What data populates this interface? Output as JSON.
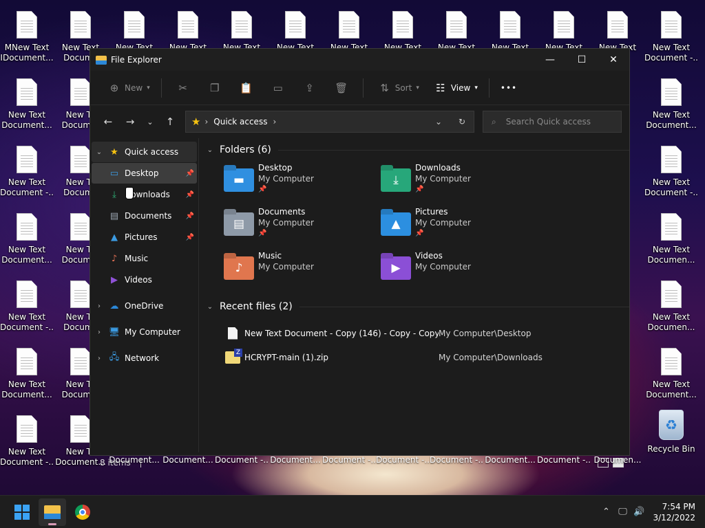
{
  "desktop": {
    "left_col1": [
      {
        "line1": "MNew Text",
        "line2": "IDocument..."
      },
      {
        "line1": "New Text",
        "line2": "Document..."
      },
      {
        "line1": "New Text",
        "line2": "Document -..."
      },
      {
        "line1": "New Text",
        "line2": "Document..."
      },
      {
        "line1": "New Text",
        "line2": "Document -..."
      },
      {
        "line1": "New Text",
        "line2": "Document..."
      },
      {
        "line1": "New Text",
        "line2": "Document -..."
      }
    ],
    "left_col2": [
      {
        "line1": "New Text",
        "line2": "Docume"
      },
      {
        "line1": "New Te",
        "line2": "Documer"
      },
      {
        "line1": "New Te",
        "line2": "Docume"
      },
      {
        "line1": "New Te",
        "line2": "Documer"
      },
      {
        "line1": "New Te",
        "line2": "Docume"
      },
      {
        "line1": "New Te",
        "line2": "Documer"
      },
      {
        "line1": "New Te",
        "line2": "Document..."
      }
    ],
    "top_row": [
      "New Text",
      "New Text",
      "New Text",
      "New Text",
      "New Text",
      "New Text",
      "New Text",
      "New Text",
      "New Text",
      "New Text"
    ],
    "right_col": [
      {
        "line1": "New Text",
        "line2": "Document -..."
      },
      {
        "line1": "New Text",
        "line2": "Document..."
      },
      {
        "line1": "New Text",
        "line2": "Document -..."
      },
      {
        "line1": "New Text",
        "line2": "Documen..."
      },
      {
        "line1": "New Text",
        "line2": "Documen..."
      },
      {
        "line1": "New Text",
        "line2": "Document..."
      }
    ],
    "recycle_bin": "Recycle Bin"
  },
  "window": {
    "title": "File Explorer",
    "controls": {
      "minimize": "—",
      "maximize": "☐",
      "close": "✕"
    }
  },
  "toolbar": {
    "new_label": "New",
    "sort_label": "Sort",
    "view_label": "View",
    "more_label": "•••"
  },
  "address": {
    "location": "Quick access",
    "search_placeholder": "Search Quick access"
  },
  "sidebar": {
    "quick_access": "Quick access",
    "pinned": [
      {
        "label": "Desktop",
        "color": "#3b9ae1"
      },
      {
        "label": "Downloads",
        "color": "#2fb57a"
      },
      {
        "label": "Documents",
        "color": "#9aa5b1"
      },
      {
        "label": "Pictures",
        "color": "#3b9ae1"
      },
      {
        "label": "Music",
        "color": "#e07055"
      },
      {
        "label": "Videos",
        "color": "#8f52d6"
      }
    ],
    "onedrive": "OneDrive",
    "my_computer": "My Computer",
    "network": "Network"
  },
  "folders_section": {
    "heading": "Folders (6)",
    "items": [
      {
        "name": "Desktop",
        "location": "My Computer",
        "pinned": true,
        "color": "#2f8fe0",
        "icon": "desktop-icon"
      },
      {
        "name": "Downloads",
        "location": "My Computer",
        "pinned": true,
        "color": "#27a77a",
        "icon": "download-icon"
      },
      {
        "name": "Documents",
        "location": "My Computer",
        "pinned": true,
        "color": "#8e9aa8",
        "icon": "documents-icon"
      },
      {
        "name": "Pictures",
        "location": "My Computer",
        "pinned": true,
        "color": "#2c8fe0",
        "icon": "pictures-icon"
      },
      {
        "name": "Music",
        "location": "My Computer",
        "pinned": false,
        "color": "#e0764e",
        "icon": "music-icon"
      },
      {
        "name": "Videos",
        "location": "My Computer",
        "pinned": false,
        "color": "#8b4fd6",
        "icon": "videos-icon"
      }
    ]
  },
  "recent_section": {
    "heading": "Recent files (2)",
    "items": [
      {
        "name": "New Text Document - Copy (146) - Copy - Copy....",
        "location": "My Computer\\Desktop"
      },
      {
        "name": "HCRYPT-main (1).zip",
        "location": "My Computer\\Downloads"
      }
    ]
  },
  "statusbar": {
    "count": "8 items"
  },
  "taskbar": {
    "time": "7:54 PM",
    "date": "3/12/2022"
  },
  "bottom_strip": [
    "Document...",
    "Document...",
    "Document -...",
    "Document...",
    "Document -...",
    "Document -...",
    "Document -...",
    "Document...",
    "Document -...",
    "Documen..."
  ]
}
